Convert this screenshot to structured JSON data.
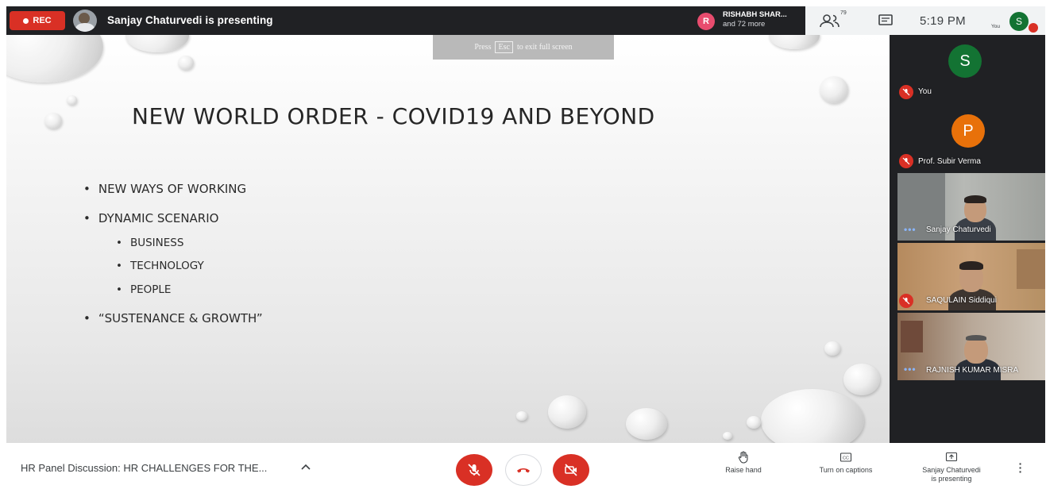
{
  "topbar": {
    "rec_label": "REC",
    "presenting_text": "Sanjay Chaturvedi is presenting",
    "participant_initial": "R",
    "participant_name": "RISHABH SHAR...",
    "participant_more": "and 72 more",
    "people_count": "79",
    "time": "5:19 PM",
    "you_label": "You",
    "self_initial": "S"
  },
  "slide": {
    "esc_hint": {
      "before": "Press",
      "key": "Esc",
      "after": "to exit full screen"
    },
    "title": "NEW WORLD ORDER - COVID19 AND BEYOND",
    "bullets": [
      "NEW WAYS OF WORKING",
      "DYNAMIC SCENARIO",
      "BUSINESS",
      "TECHNOLOGY",
      "PEOPLE",
      "“SUSTENANCE & GROWTH”"
    ],
    "bullet_glyph": "•"
  },
  "participants": [
    {
      "initial": "S",
      "name": "You",
      "color": "#137333"
    },
    {
      "initial": "P",
      "name": "Prof. Subir Verma",
      "color": "#e8710a"
    },
    {
      "name": "Sanjay Chaturvedi"
    },
    {
      "name": "SAQULAIN Siddiqui"
    },
    {
      "name": "RAJNISH KUMAR MISRA"
    }
  ],
  "bottombar": {
    "meeting_title": "HR Panel Discussion: HR CHALLENGES FOR THE...",
    "raise_hand": "Raise hand",
    "captions": "Turn on captions",
    "presenting_line1": "Sanjay Chaturvedi",
    "presenting_line2": "is presenting"
  },
  "colors": {
    "meet_dark": "#202124",
    "danger_red": "#d93025",
    "tile_dots": "#8ab4f8"
  },
  "icons": [
    "record-dot-icon",
    "people-icon",
    "chat-icon",
    "mic-off-icon",
    "hang-up-icon",
    "camera-off-icon",
    "raise-hand-icon",
    "captions-icon",
    "present-icon",
    "more-options-icon",
    "chevron-up-icon"
  ]
}
